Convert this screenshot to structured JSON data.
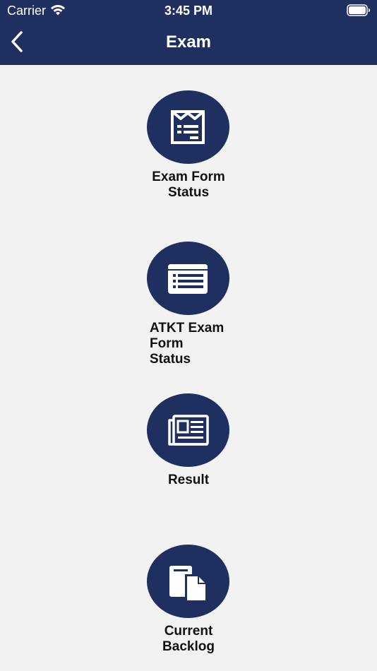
{
  "status_bar": {
    "carrier": "Carrier",
    "time": "3:45 PM",
    "wifi_icon": "wifi-icon",
    "battery_icon": "battery-icon"
  },
  "nav": {
    "title": "Exam",
    "back_icon": "chevron-left-icon"
  },
  "menu": [
    {
      "label": "Exam Form\nStatus",
      "icon": "exam-form-icon"
    },
    {
      "label": "ATKT Exam\nForm\nStatus",
      "icon": "list-card-icon"
    },
    {
      "label": "Result",
      "icon": "newspaper-icon"
    },
    {
      "label": "Current\nBacklog",
      "icon": "documents-icon"
    }
  ],
  "colors": {
    "primary": "#1f3060",
    "background": "#f2f2f3",
    "text": "#111111"
  }
}
